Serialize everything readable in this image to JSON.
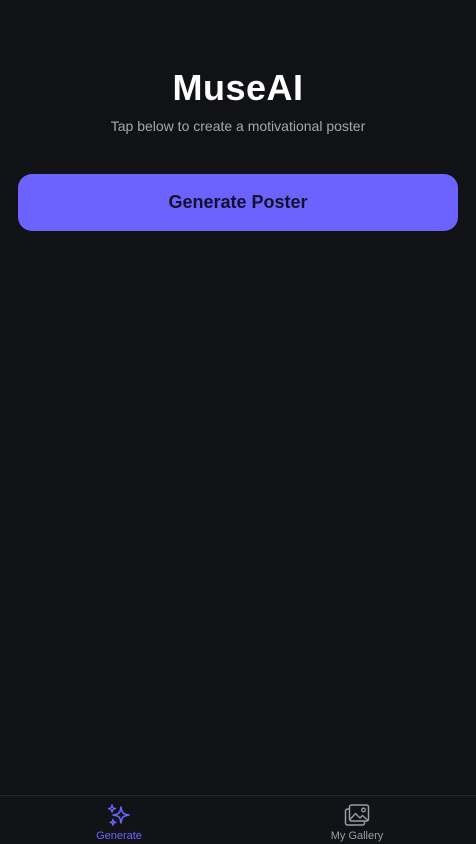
{
  "app": {
    "title": "MuseAI",
    "subtitle": "Tap below to create a motivational poster"
  },
  "main": {
    "generate_button_label": "Generate Poster"
  },
  "tab_bar": {
    "tabs": [
      {
        "label": "Generate",
        "icon": "sparkles-icon",
        "active": true
      },
      {
        "label": "My Gallery",
        "icon": "gallery-icon",
        "active": false
      }
    ]
  },
  "colors": {
    "background": "#111216",
    "accent": "#6c63ff",
    "subtitle_text": "#a5a7b0",
    "inactive_tab": "#9a9ca5"
  }
}
